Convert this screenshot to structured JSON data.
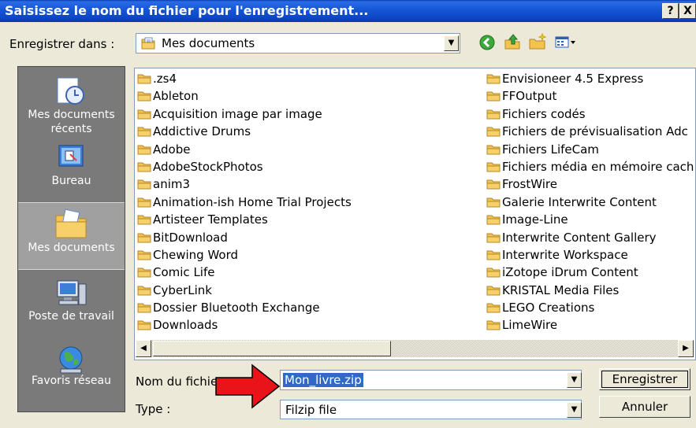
{
  "window": {
    "title": "Saisissez le nom du fichier pour l'enregistrement...",
    "help_label": "?",
    "close_label": "X"
  },
  "savein": {
    "label": "Enregistrer dans :",
    "value": "Mes documents",
    "icon": "my-documents-folder-icon"
  },
  "toolbar": {
    "back_icon": "back-arrow-icon",
    "up_icon": "up-folder-icon",
    "new_folder_icon": "new-folder-icon",
    "view_icon": "view-menu-icon"
  },
  "places": [
    {
      "label": "Mes documents récents",
      "icon": "recent-documents-icon",
      "selected": false
    },
    {
      "label": "Bureau",
      "icon": "desktop-icon",
      "selected": false
    },
    {
      "label": "Mes documents",
      "icon": "my-documents-icon",
      "selected": true
    },
    {
      "label": "Poste de travail",
      "icon": "my-computer-icon",
      "selected": false
    },
    {
      "label": "Favoris réseau",
      "icon": "network-places-icon",
      "selected": false
    }
  ],
  "files": {
    "left": [
      ".zs4",
      "Ableton",
      "Acquisition image par image",
      "Addictive Drums",
      "Adobe",
      "AdobeStockPhotos",
      "anim3",
      "Animation-ish Home Trial Projects",
      "Artisteer Templates",
      "BitDownload",
      "Chewing Word",
      "Comic Life",
      "CyberLink",
      "Dossier Bluetooth Exchange",
      "Downloads"
    ],
    "right": [
      "Envisioneer 4.5 Express",
      "FFOutput",
      "Fichiers codés",
      "Fichiers de prévisualisation Adc",
      "Fichiers LifeCam",
      "Fichiers média en mémoire cach",
      "FrostWire",
      "Galerie Interwrite Content",
      "Image-Line",
      "Interwrite Content Gallery",
      "Interwrite Workspace",
      "iZotope iDrum Content",
      "KRISTAL Media Files",
      "LEGO Creations",
      "LimeWire"
    ]
  },
  "filename": {
    "label": "Nom du fichie",
    "value": "Mon_livre.zip"
  },
  "filetype": {
    "label": "Type :",
    "value": "Filzip file"
  },
  "buttons": {
    "save": "Enregistrer",
    "cancel": "Annuler"
  },
  "annotation": {
    "arrow_color": "#e8141a"
  },
  "colors": {
    "title_bar": "#1556d6",
    "selection": "#316ac5",
    "places_bar": "#7a7a7a",
    "folder": "#f3c24f"
  }
}
